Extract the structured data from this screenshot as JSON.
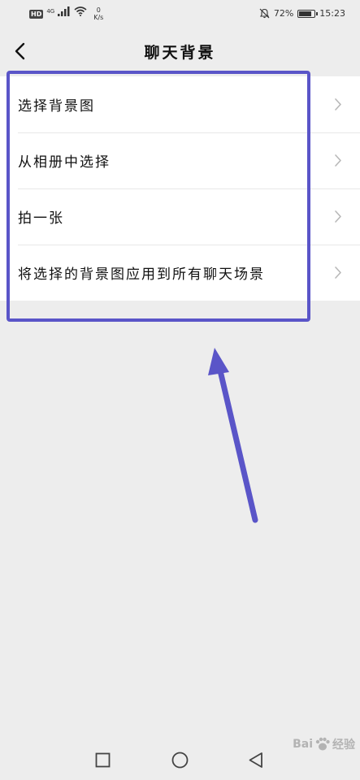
{
  "status_bar": {
    "hd_badge": "HD",
    "network": "4G",
    "speed_value": "0",
    "speed_unit": "K/s",
    "battery_text": "72%",
    "time": "15:23"
  },
  "header": {
    "title": "聊天背景",
    "back_icon": "chevron-left-icon"
  },
  "menu": {
    "items": [
      {
        "label": "选择背景图"
      },
      {
        "label": "从相册中选择"
      },
      {
        "label": "拍一张"
      },
      {
        "label": "将选择的背景图应用到所有聊天场景"
      }
    ]
  },
  "annotation": {
    "color": "#5a55c8"
  },
  "system_nav": {
    "buttons": [
      "recent-apps",
      "home",
      "back"
    ]
  },
  "watermark": {
    "brand": "Bai",
    "suffix": "经验"
  }
}
